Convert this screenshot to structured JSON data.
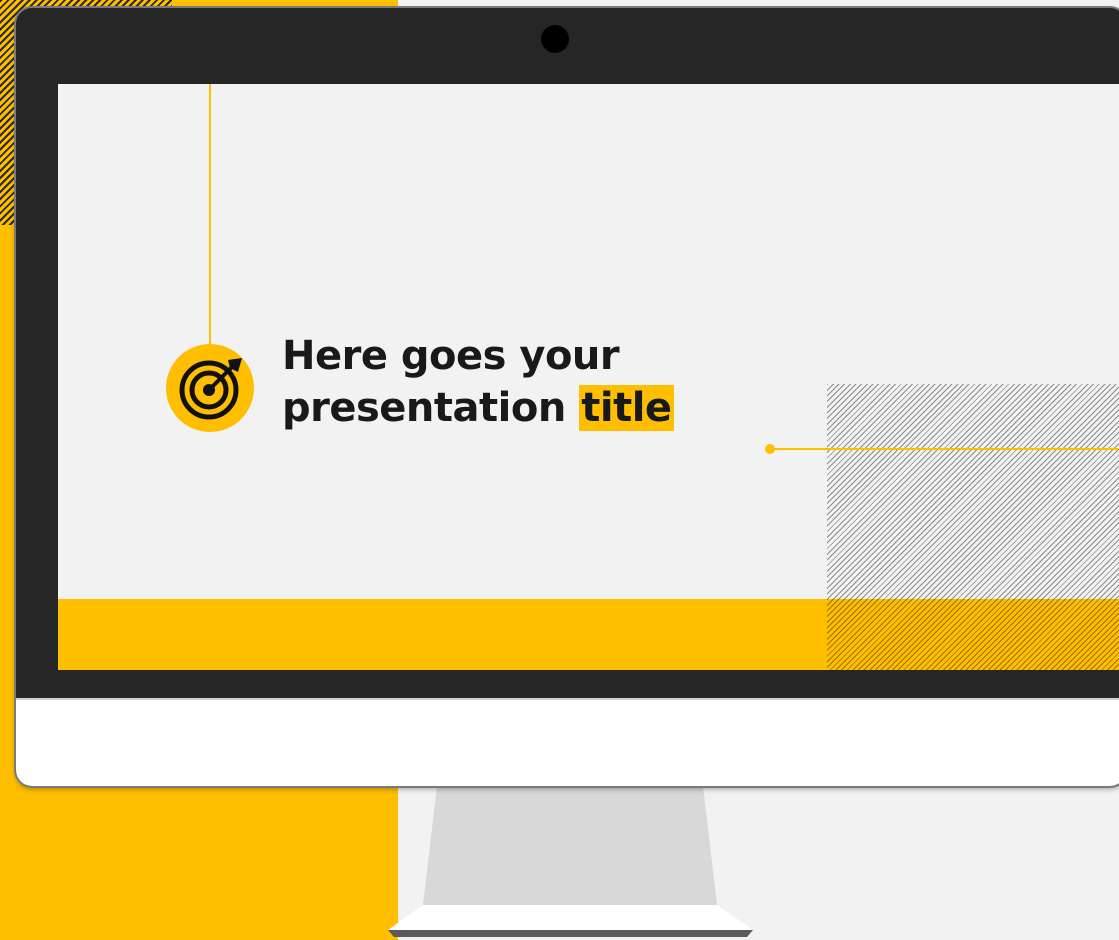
{
  "slide": {
    "title_line1": "Here goes your",
    "title_line2_prefix": "presentation ",
    "title_highlight": "title"
  },
  "colors": {
    "accent": "#FFBE00",
    "bezel": "#262626",
    "screen_bg": "#f2f2f2",
    "chin": "#ffffff",
    "text": "#191919"
  },
  "icons": {
    "badge": "target-arrow-icon",
    "camera": "camera-icon"
  }
}
